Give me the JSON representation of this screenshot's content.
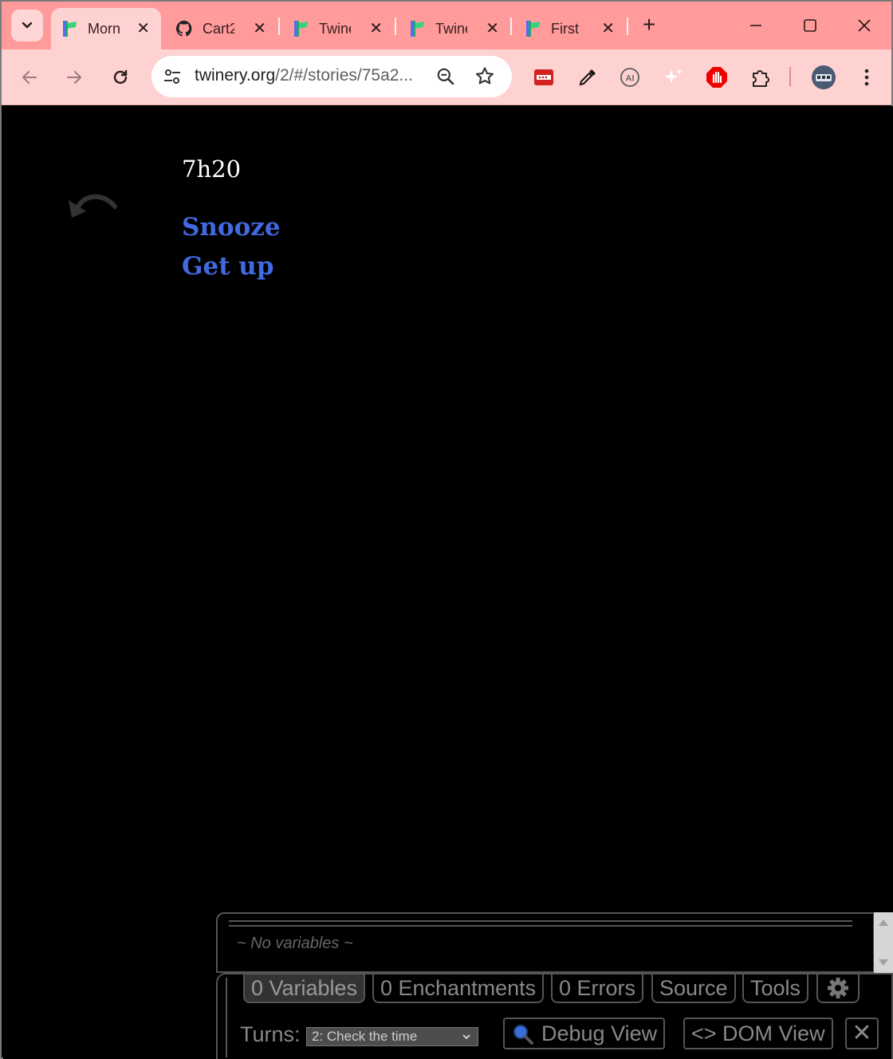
{
  "browser": {
    "tabs": [
      {
        "title": "Morning",
        "favicon": "twine-icon",
        "active": true
      },
      {
        "title": "Cart2",
        "favicon": "github-icon",
        "active": false
      },
      {
        "title": "Twine",
        "favicon": "twine-icon",
        "active": false
      },
      {
        "title": "Twine",
        "favicon": "twine-icon",
        "active": false
      },
      {
        "title": "First",
        "favicon": "twine-icon",
        "active": false
      }
    ],
    "tab_close_glyph": "✕",
    "new_tab_glyph": "+",
    "url_host": "twinery.org",
    "url_path": "/2/#/stories/75a2...",
    "colors": {
      "tabbar": "#ff9b9b",
      "toolbar": "#ffd2d2"
    }
  },
  "story": {
    "passage_title": "7h20",
    "links": [
      "Snooze",
      "Get up"
    ],
    "link_color": "#4169e1"
  },
  "debug": {
    "no_variables": "~ No variables ~",
    "tabs": [
      "0 Variables",
      "0 Enchantments",
      "0 Errors",
      "Source",
      "Tools"
    ],
    "turns_label": "Turns:",
    "turns_selected": "2: Check the time",
    "debug_view": "Debug View",
    "dom_view": "<> DOM View",
    "close_glyph": "✕"
  }
}
